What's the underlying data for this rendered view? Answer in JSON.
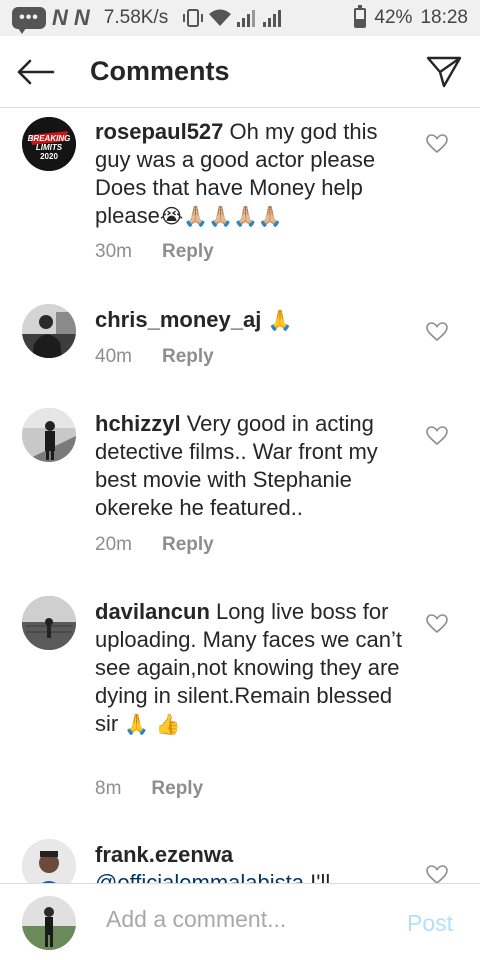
{
  "status_bar": {
    "chat_icon_text": "•••",
    "n1": "N",
    "n2": "N",
    "speed": "7.58K/s",
    "battery_percent": "42%",
    "battery_level": 0.42,
    "time": "18:28"
  },
  "header": {
    "title": "Comments",
    "back_icon": "arrow-left-icon",
    "send_icon": "paper-plane-icon"
  },
  "comments": [
    {
      "username": "rosepaul527",
      "text": " Oh my god this guy was a good actor please Does that have Money help please",
      "emojis": "😭🙏🏼🙏🏼🙏🏼🙏🏼",
      "time": "30m",
      "reply": "Reply",
      "avatar_text": "BREAKING LIMITS 2020"
    },
    {
      "username": "chris_money_aj",
      "text": " ",
      "emojis": "🙏",
      "time": "40m",
      "reply": "Reply"
    },
    {
      "username": "hchizzyl",
      "text": " Very good in acting detective films.. War front my best movie with Stephanie okereke he featured..",
      "emojis": "",
      "time": "20m",
      "reply": "Reply"
    },
    {
      "username": "davilancun",
      "text": " Long live boss for uploading. Many faces we can’t see again,not knowing they are dying in silent.Remain blessed sir ",
      "emojis": "🙏 👍",
      "time": "8m",
      "reply": "Reply"
    },
    {
      "username": "frank.ezenwa",
      "mention": "@officialemmalabista",
      "text": " I'll",
      "emojis": "",
      "time": "",
      "reply": ""
    }
  ],
  "footer": {
    "placeholder": "Add a comment...",
    "post_label": "Post"
  },
  "colors": {
    "text": "#262626",
    "meta": "#8e8e8e",
    "post_disabled": "#b2dffc",
    "mention": "#003569",
    "divider": "#dbdbdb"
  }
}
